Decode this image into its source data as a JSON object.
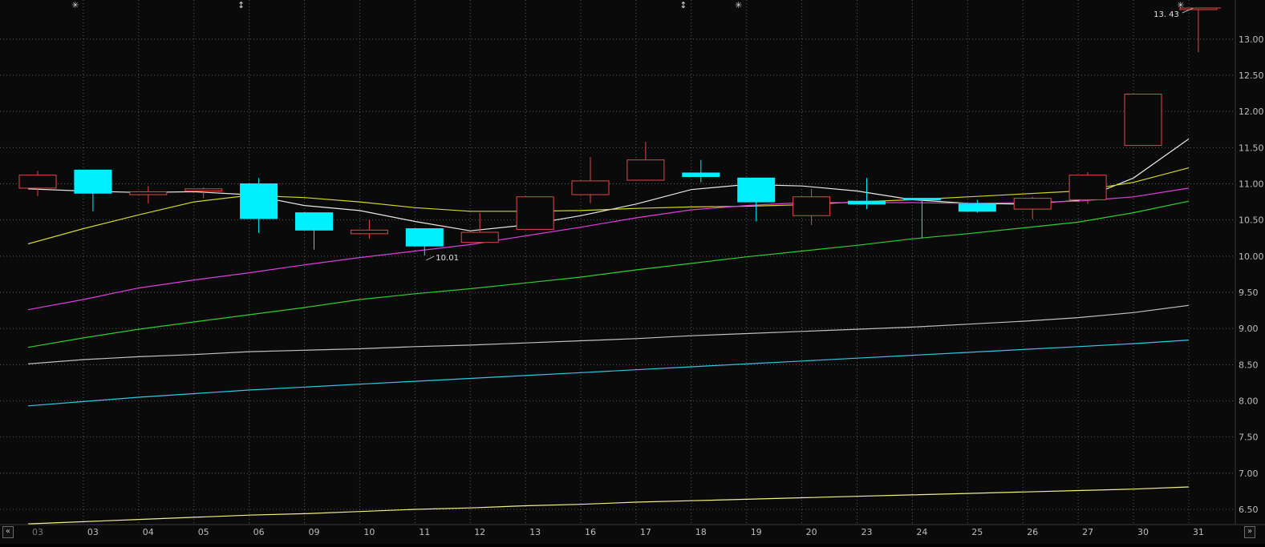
{
  "chart_data": {
    "type": "candlestick",
    "x": [
      "03",
      "03",
      "04",
      "05",
      "06",
      "09",
      "10",
      "11",
      "12",
      "13",
      "16",
      "17",
      "18",
      "19",
      "20",
      "23",
      "24",
      "25",
      "26",
      "27",
      "30",
      "31"
    ],
    "candles": [
      {
        "x": "03",
        "open": 10.94,
        "high": 11.18,
        "low": 10.83,
        "close": 11.12,
        "color": "#e04848"
      },
      {
        "x": "03",
        "open": 11.19,
        "high": 11.19,
        "low": 10.62,
        "close": 10.87,
        "color": "#00f0ff"
      },
      {
        "x": "04",
        "open": 10.85,
        "high": 10.97,
        "low": 10.73,
        "close": 10.89,
        "color": "#e04848"
      },
      {
        "x": "05",
        "open": 10.9,
        "high": 10.95,
        "low": 10.8,
        "close": 10.93,
        "color": "#e04848"
      },
      {
        "x": "06",
        "open": 11.0,
        "high": 11.08,
        "low": 10.32,
        "close": 10.52,
        "color": "#00f0ff"
      },
      {
        "x": "09",
        "open": 10.6,
        "high": 10.6,
        "low": 10.09,
        "close": 10.36,
        "color": "#00f0ff"
      },
      {
        "x": "10",
        "open": 10.31,
        "high": 10.5,
        "low": 10.24,
        "close": 10.36,
        "color": "#e04848"
      },
      {
        "x": "11",
        "open": 10.38,
        "high": 10.38,
        "low": 10.01,
        "close": 10.14,
        "color": "#00f0ff"
      },
      {
        "x": "12",
        "open": 10.19,
        "high": 10.6,
        "low": 10.19,
        "close": 10.33,
        "color": "#e04848"
      },
      {
        "x": "13",
        "open": 10.37,
        "high": 10.82,
        "low": 10.37,
        "close": 10.82,
        "color": "#e04848"
      },
      {
        "x": "16",
        "open": 10.85,
        "high": 11.37,
        "low": 10.73,
        "close": 11.04,
        "color": "#e04848"
      },
      {
        "x": "17",
        "open": 11.05,
        "high": 11.58,
        "low": 11.05,
        "close": 11.33,
        "color": "#e04848"
      },
      {
        "x": "18",
        "open": 11.15,
        "high": 11.33,
        "low": 11.02,
        "close": 11.1,
        "color": "#00f0ff"
      },
      {
        "x": "19",
        "open": 11.08,
        "high": 11.08,
        "low": 10.48,
        "close": 10.75,
        "color": "#00f0ff"
      },
      {
        "x": "20",
        "open": 10.56,
        "high": 10.93,
        "low": 10.43,
        "close": 10.82,
        "color": "#e04848"
      },
      {
        "x": "23",
        "open": 10.76,
        "high": 11.08,
        "low": 10.65,
        "close": 10.72,
        "color": "#00f0ff"
      },
      {
        "x": "24",
        "open": 10.8,
        "high": 10.8,
        "low": 10.25,
        "close": 10.78,
        "color": "#00f0ff"
      },
      {
        "x": "25",
        "open": 10.72,
        "high": 10.78,
        "low": 10.6,
        "close": 10.62,
        "color": "#00f0ff"
      },
      {
        "x": "26",
        "open": 10.65,
        "high": 10.82,
        "low": 10.51,
        "close": 10.8,
        "color": "#e04848"
      },
      {
        "x": "27",
        "open": 10.78,
        "high": 11.16,
        "low": 10.72,
        "close": 11.12,
        "color": "#e04848"
      },
      {
        "x": "30",
        "open": 11.53,
        "high": 12.24,
        "low": 11.53,
        "close": 12.24,
        "color": "#e04848"
      },
      {
        "x": "31",
        "open": 13.43,
        "high": 13.43,
        "low": 12.82,
        "close": 13.43,
        "color": "#e04848"
      }
    ],
    "series": [
      {
        "color": "#e8e8e8",
        "values": [
          10.93,
          10.9,
          10.88,
          10.89,
          10.85,
          10.7,
          10.63,
          10.48,
          10.35,
          10.43,
          10.56,
          10.72,
          10.92,
          10.99,
          10.97,
          10.9,
          10.78,
          10.73,
          10.72,
          10.77,
          11.08,
          11.62
        ]
      },
      {
        "color": "#d6d625",
        "values": [
          10.17,
          10.38,
          10.57,
          10.75,
          10.84,
          10.81,
          10.75,
          10.67,
          10.62,
          10.62,
          10.63,
          10.66,
          10.68,
          10.69,
          10.71,
          10.75,
          10.78,
          10.82,
          10.86,
          10.9,
          11.02,
          11.22
        ]
      },
      {
        "color": "#e03ce0",
        "values": [
          9.26,
          9.4,
          9.56,
          9.67,
          9.77,
          9.88,
          9.98,
          10.07,
          10.16,
          10.28,
          10.4,
          10.53,
          10.64,
          10.7,
          10.74,
          10.74,
          10.74,
          10.73,
          10.74,
          10.76,
          10.82,
          10.94
        ]
      },
      {
        "color": "#2ecf2e",
        "values": [
          8.74,
          8.87,
          8.99,
          9.09,
          9.19,
          9.29,
          9.4,
          9.48,
          9.55,
          9.63,
          9.71,
          9.81,
          9.9,
          9.99,
          10.07,
          10.15,
          10.24,
          10.31,
          10.39,
          10.47,
          10.6,
          10.76
        ]
      },
      {
        "color": "#c0c0c0",
        "values": [
          8.51,
          8.57,
          8.61,
          8.64,
          8.68,
          8.7,
          8.72,
          8.75,
          8.77,
          8.8,
          8.83,
          8.86,
          8.9,
          8.93,
          8.96,
          8.99,
          9.02,
          9.06,
          9.1,
          9.15,
          9.22,
          9.32
        ]
      },
      {
        "color": "#31c7e8",
        "values": [
          7.93,
          7.99,
          8.05,
          8.1,
          8.15,
          8.19,
          8.23,
          8.27,
          8.31,
          8.35,
          8.39,
          8.43,
          8.47,
          8.51,
          8.55,
          8.59,
          8.63,
          8.67,
          8.71,
          8.75,
          8.79,
          8.84
        ]
      },
      {
        "color": "#f0f08a",
        "values": [
          6.3,
          6.33,
          6.36,
          6.39,
          6.42,
          6.44,
          6.47,
          6.5,
          6.52,
          6.55,
          6.57,
          6.6,
          6.62,
          6.64,
          6.66,
          6.68,
          6.7,
          6.72,
          6.74,
          6.76,
          6.78,
          6.81
        ]
      }
    ],
    "ylim": [
      6.3,
      13.6
    ],
    "yticks": [
      6.5,
      7.0,
      7.5,
      8.0,
      8.5,
      9.0,
      9.5,
      10.0,
      10.5,
      11.0,
      11.5,
      12.0,
      12.5,
      13.0
    ],
    "ytick_labels": [
      "6.50",
      "7.00",
      "7.50",
      "8.00",
      "8.50",
      "9.00",
      "9.50",
      "10.00",
      "10.50",
      "11.00",
      "11.50",
      "12.00",
      "12.50",
      "13.00"
    ],
    "grid": true,
    "annotations": [
      {
        "text": "10.01",
        "x_index": 7,
        "y": 10.01
      },
      {
        "text": "13. 43",
        "x_index": 21,
        "y": 13.43
      }
    ],
    "markers": [
      {
        "symbol": "✳",
        "x_index": 1
      },
      {
        "symbol": "↕",
        "x_index": 4
      },
      {
        "symbol": "↕",
        "x_index": 12
      },
      {
        "symbol": "✳",
        "x_index": 13
      },
      {
        "symbol": "✳",
        "x_index": 21
      }
    ]
  },
  "colors": {
    "background": "#0a0a0a",
    "grid": "#5a5a5a",
    "axis_text": "#bdbdbd",
    "annotation_text": "#e0e0e0"
  },
  "nav": {
    "left_icon": "«",
    "right_icon": "»"
  }
}
